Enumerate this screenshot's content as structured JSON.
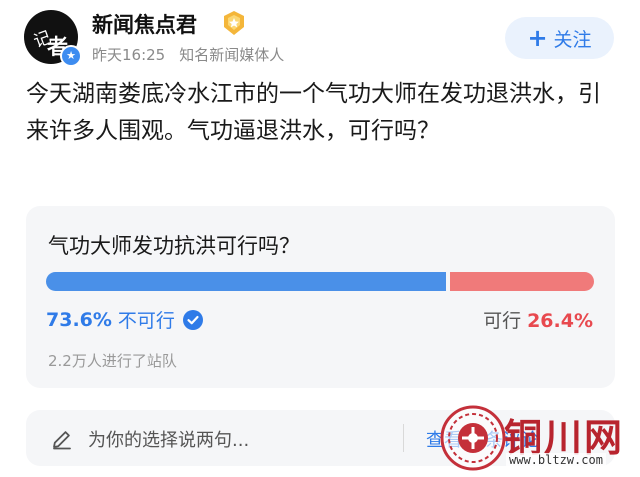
{
  "author": {
    "avatar_text": [
      "记",
      "者"
    ],
    "name": "新闻焦点君",
    "time": "昨天16:25",
    "tag": "知名新闻媒体人"
  },
  "follow_button": {
    "plus": "+",
    "label": "关注"
  },
  "post": {
    "text": "今天湖南娄底冷水江市的一个气功大师在发功退洪水，引来许多人围观。气功逼退洪水，可行吗？"
  },
  "poll": {
    "question": "气功大师发功抗洪可行吗？",
    "options": [
      {
        "percent": "73.6%",
        "label": "不可行",
        "fraction": 0.736,
        "color": "#4a90e8",
        "selected": true
      },
      {
        "percent": "26.4%",
        "label": "可行",
        "fraction": 0.264,
        "color": "#f07a7a",
        "selected": false
      }
    ],
    "participants": "2.2万人进行了站队"
  },
  "comment_bar": {
    "placeholder": "为你的选择说两句...",
    "view_link": "查看56条评论"
  },
  "watermark": {
    "title": "铜川网",
    "url": "www.bltzw.com"
  },
  "colors": {
    "accent": "#2f7be8",
    "negative": "#e8494f"
  }
}
